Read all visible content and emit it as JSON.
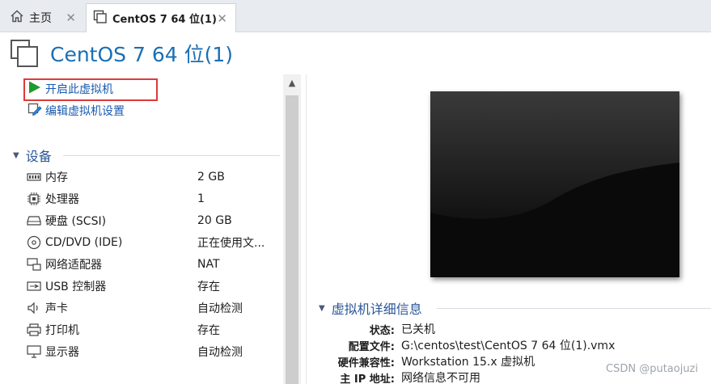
{
  "tabs": [
    {
      "label": "主页",
      "icon": "home-icon"
    },
    {
      "label": "CentOS 7 64 位(1)",
      "icon": "vm-icon"
    }
  ],
  "vm": {
    "title": "CentOS 7 64 位(1)"
  },
  "actions": {
    "start_label": "开启此虚拟机",
    "edit_label": "编辑虚拟机设置"
  },
  "devices": {
    "header": "设备",
    "items": [
      {
        "name": "内存",
        "value": "2 GB",
        "icon": "memory-icon"
      },
      {
        "name": "处理器",
        "value": "1",
        "icon": "cpu-icon"
      },
      {
        "name": "硬盘 (SCSI)",
        "value": "20 GB",
        "icon": "harddisk-icon"
      },
      {
        "name": "CD/DVD (IDE)",
        "value": "正在使用文...",
        "icon": "cd-dvd-icon"
      },
      {
        "name": "网络适配器",
        "value": "NAT",
        "icon": "network-icon"
      },
      {
        "name": "USB 控制器",
        "value": "存在",
        "icon": "usb-icon"
      },
      {
        "name": "声卡",
        "value": "自动检测",
        "icon": "speaker-icon"
      },
      {
        "name": "打印机",
        "value": "存在",
        "icon": "printer-icon"
      },
      {
        "name": "显示器",
        "value": "自动检测",
        "icon": "monitor-icon"
      }
    ]
  },
  "details": {
    "header": "虚拟机详细信息",
    "rows": [
      {
        "key": "状态:",
        "value": "已关机"
      },
      {
        "key": "配置文件:",
        "value": "G:\\centos\\test\\CentOS 7 64 位(1).vmx"
      },
      {
        "key": "硬件兼容性:",
        "value": "Workstation 15.x 虚拟机"
      },
      {
        "key": "主 IP 地址:",
        "value": "网络信息不可用"
      }
    ]
  },
  "watermark": "CSDN @putaojuzi",
  "colors": {
    "accent": "#1a6fb5",
    "highlight": "#e03a3a",
    "play": "#1e9a2e"
  }
}
